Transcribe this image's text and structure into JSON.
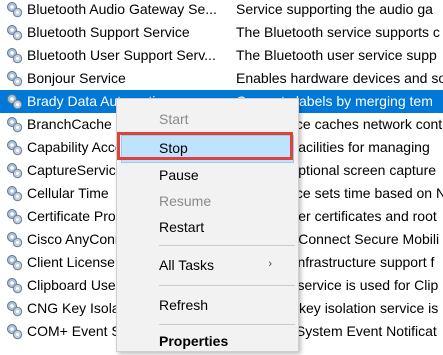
{
  "services": [
    {
      "name": "Bluetooth Audio Gateway Se...",
      "description": "Service supporting the audio ga"
    },
    {
      "name": "Bluetooth Support Service",
      "description": "The Bluetooth service supports c"
    },
    {
      "name": "Bluetooth User Support Serv...",
      "description": "The Bluetooth user service supp"
    },
    {
      "name": "Bonjour Service",
      "description": "Enables hardware devices and so"
    },
    {
      "name": "Brady Data Automation",
      "description": "Converts labels by merging tem"
    },
    {
      "name": "BranchCache",
      "description": "This service caches network cont"
    },
    {
      "name": "Capability Access Manager",
      "description": "Provides facilities for managing"
    },
    {
      "name": "CaptureService",
      "description": "Enables optional screen capture"
    },
    {
      "name": "Cellular Time",
      "description": "This service sets time based on N"
    },
    {
      "name": "Certificate Propagation",
      "description": "Copies user certificates and root"
    },
    {
      "name": "Cisco AnyConnect",
      "description": "Cisco AnyConnect Secure Mobili"
    },
    {
      "name": "Client License Service",
      "description": "Provides infrastructure support f"
    },
    {
      "name": "Clipboard User Service",
      "description": "This user service is used for Clip"
    },
    {
      "name": "CNG Key Isolation",
      "description": "The CNG key isolation service is"
    },
    {
      "name": "COM+ Event System",
      "description": "Supports System Event Notificat"
    }
  ],
  "selected_index": 4,
  "context_menu": {
    "items": [
      {
        "label": "Start",
        "state": "disabled"
      },
      {
        "label": "Stop",
        "state": "highlighted"
      },
      {
        "label": "Pause",
        "state": "normal"
      },
      {
        "label": "Resume",
        "state": "disabled"
      },
      {
        "label": "Restart",
        "state": "normal"
      },
      {
        "label": "All Tasks",
        "state": "submenu"
      },
      {
        "label": "Refresh",
        "state": "normal"
      },
      {
        "label": "Properties",
        "state": "bold"
      }
    ],
    "submenu_arrow": "›"
  },
  "colors": {
    "selection": "#0078d7",
    "highlight": "#bde3ff",
    "annotation": "#e0413b"
  },
  "icons": {
    "service": "gear-icon"
  }
}
